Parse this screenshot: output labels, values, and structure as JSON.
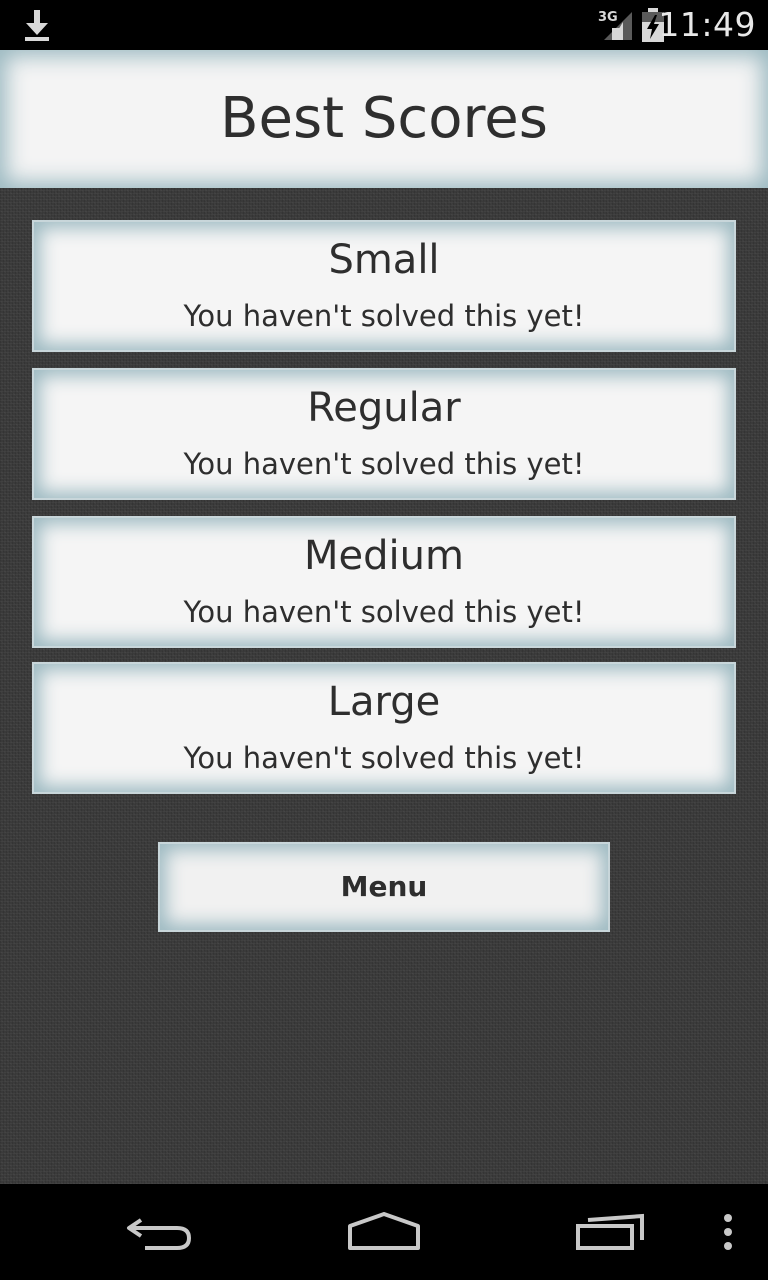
{
  "status_bar": {
    "network": "3G",
    "time": "11:49",
    "icons": [
      "download-icon",
      "signal-icon",
      "battery-icon"
    ]
  },
  "header": {
    "title": "Best Scores"
  },
  "scores": [
    {
      "size": "Small",
      "status": "You haven't solved this yet!"
    },
    {
      "size": "Regular",
      "status": "You haven't solved this yet!"
    },
    {
      "size": "Medium",
      "status": "You haven't solved this yet!"
    },
    {
      "size": "Large",
      "status": "You haven't solved this yet!"
    }
  ],
  "menu_button": {
    "label": "Menu"
  },
  "nav_bar": {
    "icons": [
      "back-icon",
      "home-icon",
      "recents-icon",
      "overflow-menu-icon"
    ]
  },
  "colors": {
    "panel_background": "#f5f5f5",
    "panel_glow": "#9cb9c1",
    "text": "#2e2e2e",
    "textured_background": "#3a3a3a",
    "system_bars": "#000000"
  }
}
